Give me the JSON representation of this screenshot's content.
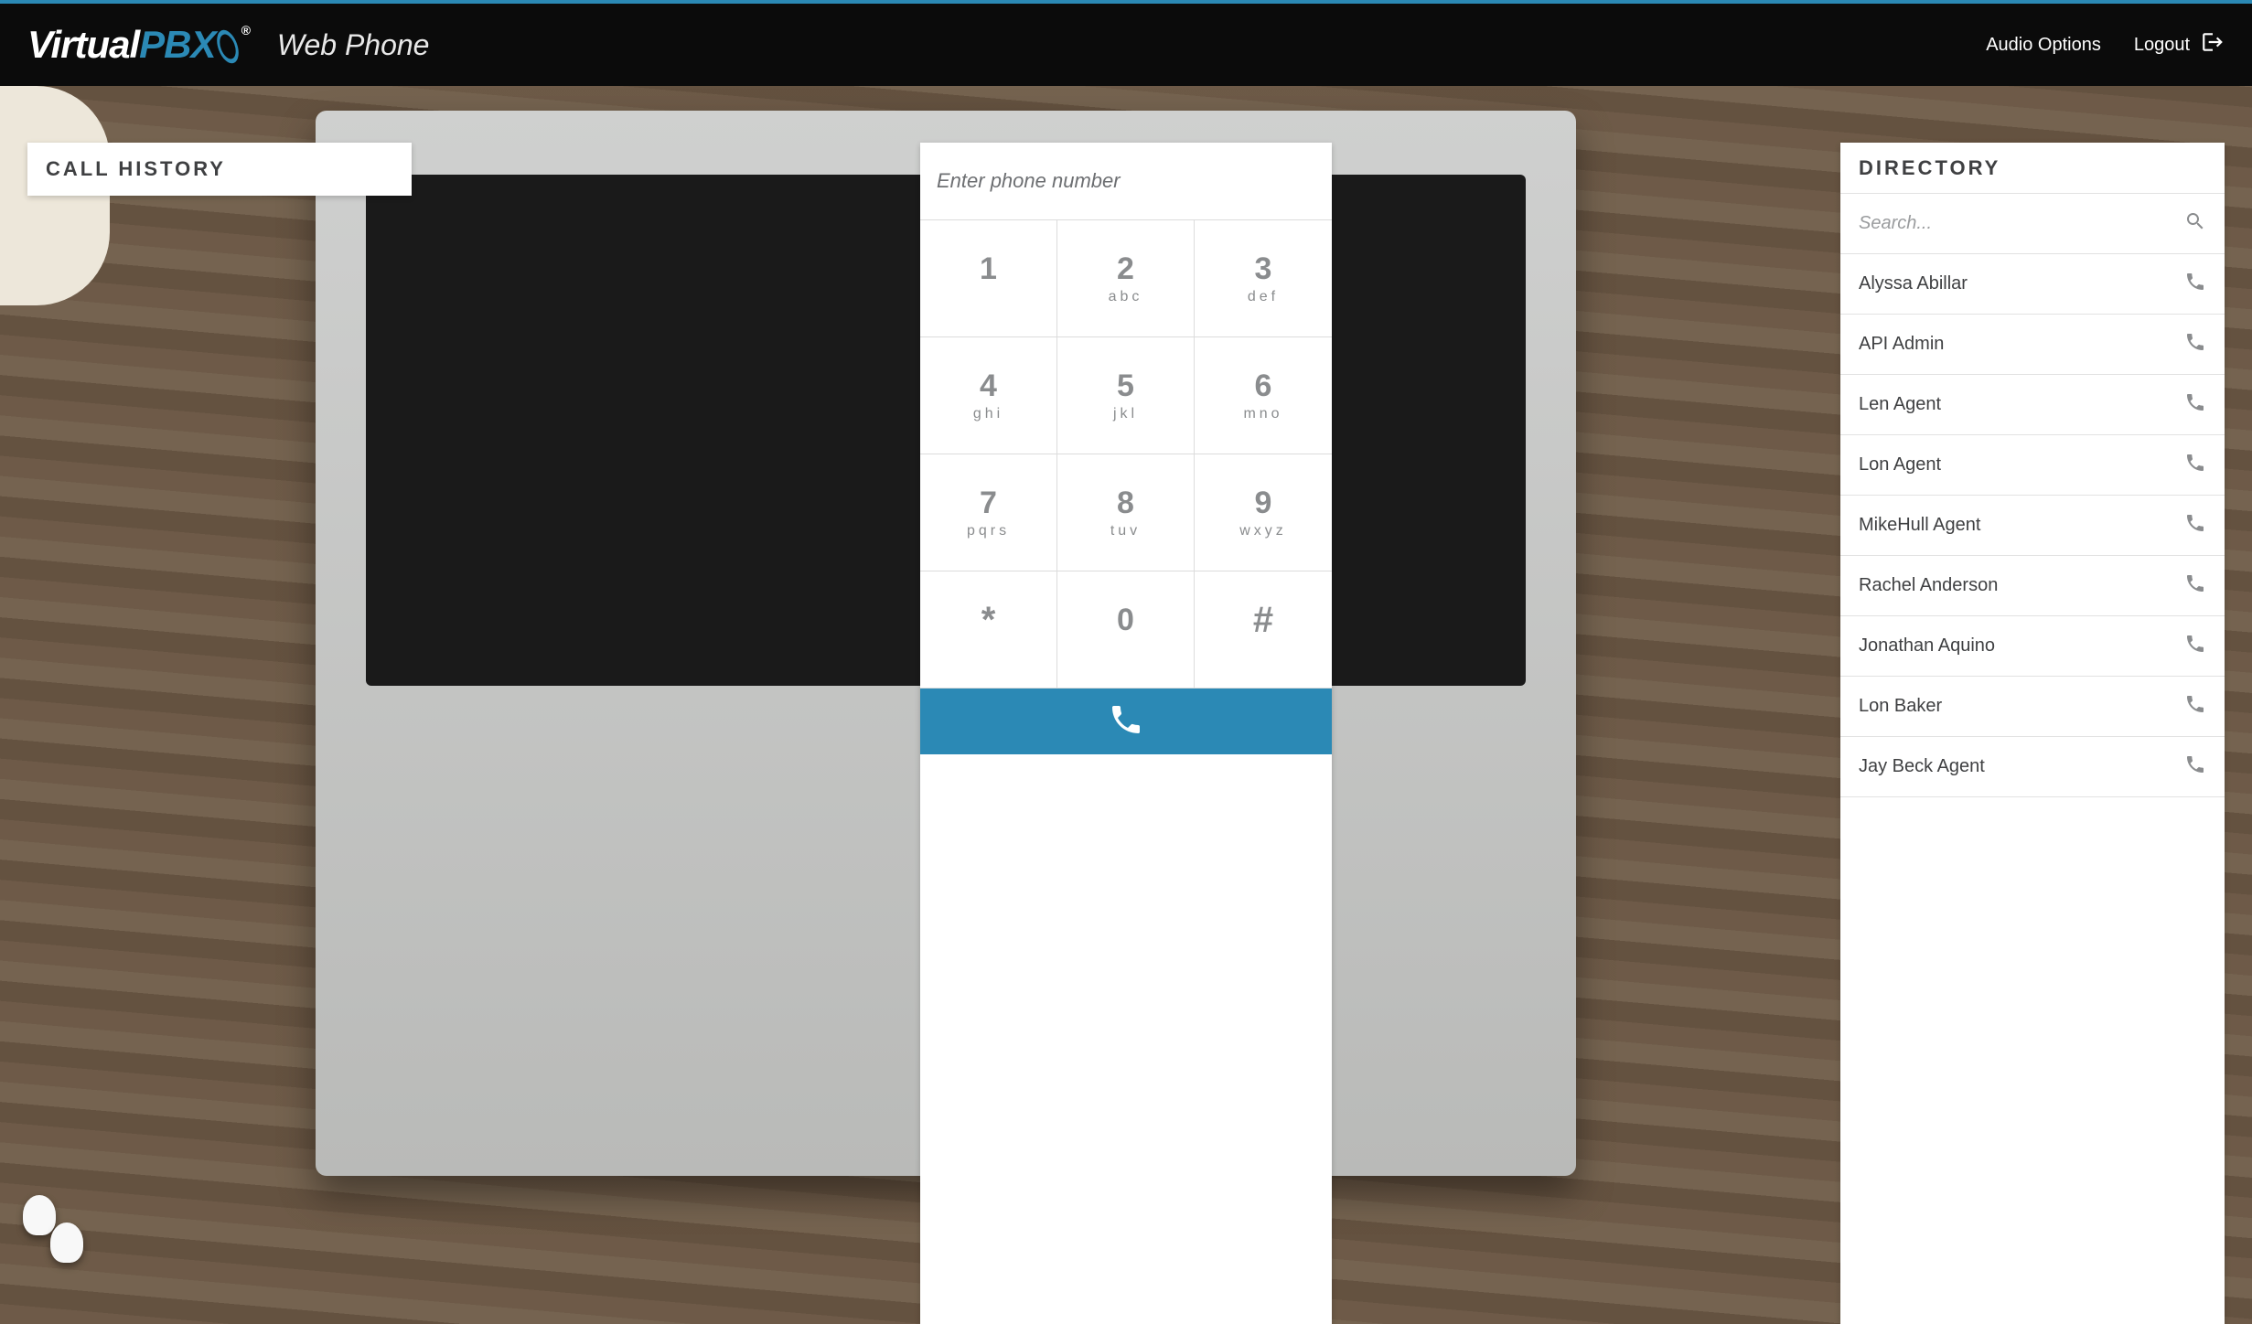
{
  "header": {
    "brand_virtual": "Virtual",
    "brand_pbx": "PBX",
    "subtitle": "Web Phone",
    "audio_options": "Audio Options",
    "logout": "Logout"
  },
  "call_history": {
    "title": "CALL HISTORY"
  },
  "dialer": {
    "placeholder": "Enter phone number",
    "keys": [
      {
        "digit": "1",
        "letters": ""
      },
      {
        "digit": "2",
        "letters": "abc"
      },
      {
        "digit": "3",
        "letters": "def"
      },
      {
        "digit": "4",
        "letters": "ghi"
      },
      {
        "digit": "5",
        "letters": "jkl"
      },
      {
        "digit": "6",
        "letters": "mno"
      },
      {
        "digit": "7",
        "letters": "pqrs"
      },
      {
        "digit": "8",
        "letters": "tuv"
      },
      {
        "digit": "9",
        "letters": "wxyz"
      },
      {
        "digit": "*",
        "letters": ""
      },
      {
        "digit": "0",
        "letters": ""
      },
      {
        "digit": "#",
        "letters": ""
      }
    ]
  },
  "directory": {
    "title": "DIRECTORY",
    "search_placeholder": "Search...",
    "contacts": [
      {
        "name": "Alyssa Abillar"
      },
      {
        "name": "API Admin"
      },
      {
        "name": "Len Agent"
      },
      {
        "name": "Lon Agent"
      },
      {
        "name": "MikeHull Agent"
      },
      {
        "name": "Rachel Anderson"
      },
      {
        "name": "Jonathan Aquino"
      },
      {
        "name": "Lon Baker"
      },
      {
        "name": "Jay Beck Agent"
      }
    ]
  },
  "colors": {
    "accent": "#2b89b5",
    "header_bg": "#0b0b0b",
    "text_muted": "#8a8c8e"
  }
}
